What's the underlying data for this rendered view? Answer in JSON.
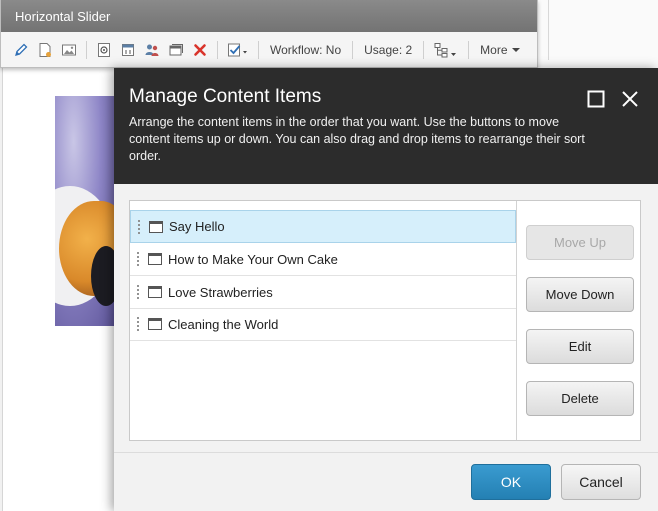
{
  "ribbon": {
    "title": "Horizontal Slider",
    "workflow_label": "Workflow: No",
    "usage_label": "Usage: 2",
    "more_label": "More"
  },
  "dialog": {
    "title": "Manage Content Items",
    "description": "Arrange the content items in the order that you want. Use the buttons to move content items up or down. You can also drag and drop items to rearrange their sort order.",
    "items": [
      {
        "label": "Say Hello",
        "selected": true
      },
      {
        "label": "How to Make Your Own Cake",
        "selected": false
      },
      {
        "label": "Love Strawberries",
        "selected": false
      },
      {
        "label": "Cleaning the World",
        "selected": false
      }
    ],
    "buttons": {
      "move_up": "Move Up",
      "move_down": "Move Down",
      "edit": "Edit",
      "delete": "Delete"
    },
    "footer": {
      "ok": "OK",
      "cancel": "Cancel"
    }
  },
  "colors": {
    "header_bg": "#2c2c2c",
    "selected_row": "#d6effb",
    "primary_button": "#2b8cc4"
  },
  "icons": [
    "edit-icon",
    "new-page-icon",
    "image-icon",
    "settings-icon",
    "publish-icon",
    "users-icon",
    "window-icon",
    "delete-icon",
    "check-icon",
    "hierarchy-icon",
    "maximize-icon",
    "close-icon",
    "drag-handle-icon",
    "content-item-icon"
  ]
}
